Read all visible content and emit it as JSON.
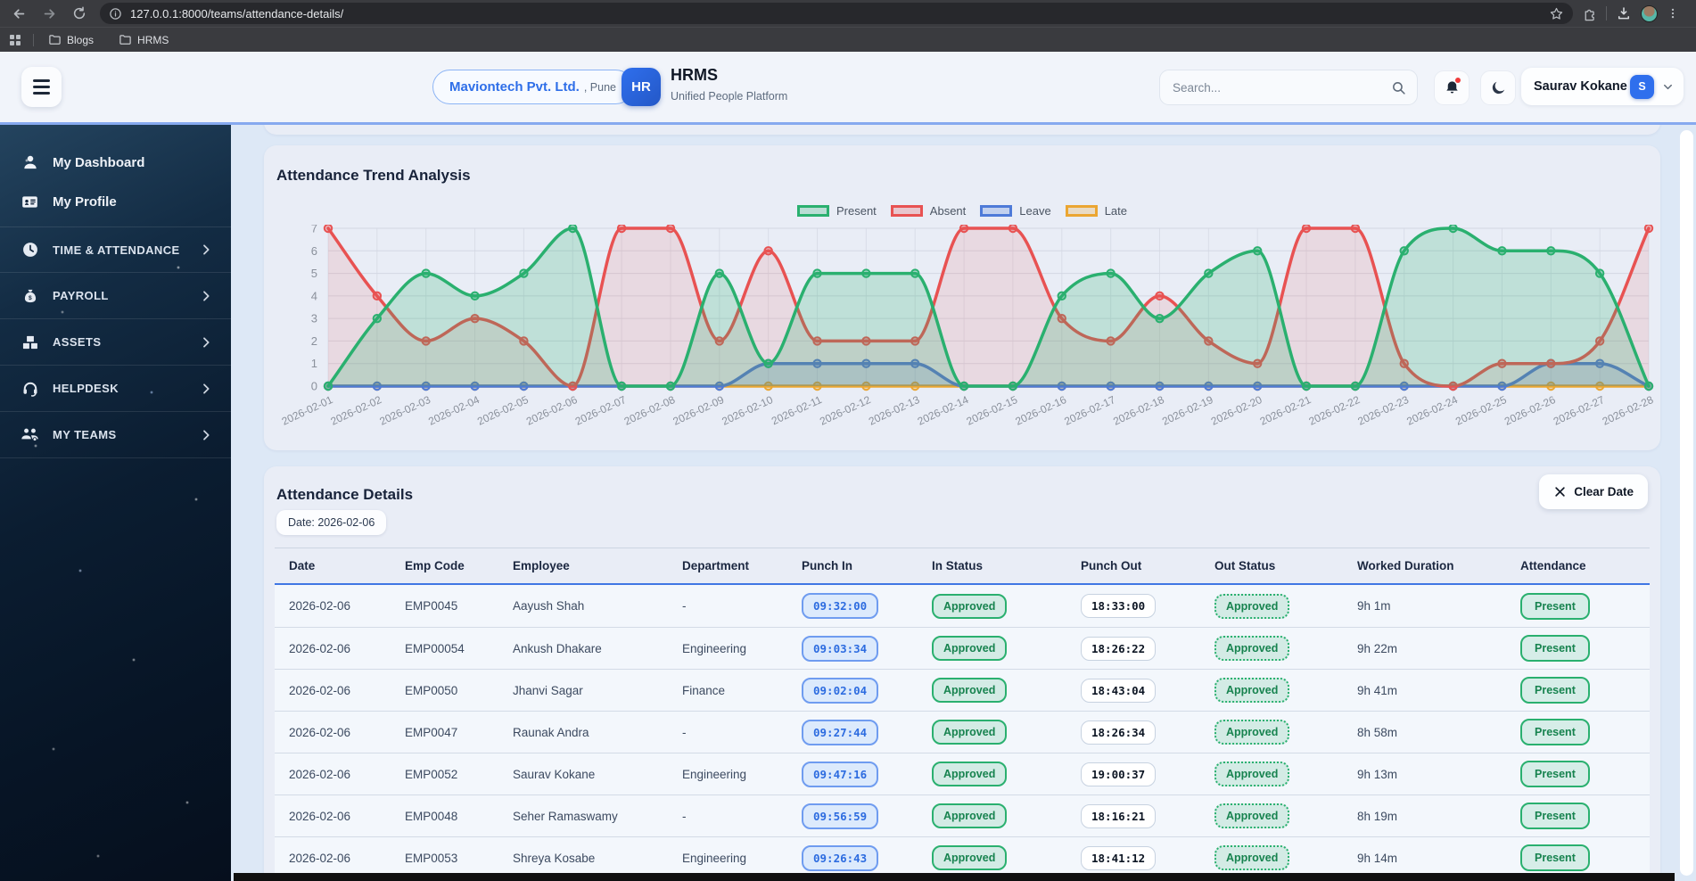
{
  "browser": {
    "url": "127.0.0.1:8000/teams/attendance-details/",
    "bookmarks": [
      {
        "label": "Blogs"
      },
      {
        "label": "HRMS"
      }
    ]
  },
  "header": {
    "company_name": "Maviontech Pvt. Ltd.",
    "company_location": ", Pune",
    "logo_text": "HR",
    "app_name": "HRMS",
    "app_tagline": "Unified People Platform",
    "search_placeholder": "Search...",
    "user_name": "Saurav Kokane",
    "user_initial": "S"
  },
  "sidebar": {
    "items": [
      {
        "label": "My Dashboard",
        "icon": "user-icon",
        "style": "primary",
        "expandable": false
      },
      {
        "label": "My Profile",
        "icon": "id-card-icon",
        "style": "primary",
        "expandable": false
      },
      {
        "label": "TIME & ATTENDANCE",
        "icon": "clock-icon",
        "style": "section",
        "expandable": true
      },
      {
        "label": "PAYROLL",
        "icon": "money-bag-icon",
        "style": "section",
        "expandable": true
      },
      {
        "label": "ASSETS",
        "icon": "boxes-icon",
        "style": "section",
        "expandable": true
      },
      {
        "label": "HELPDESK",
        "icon": "headset-icon",
        "style": "section",
        "expandable": true
      },
      {
        "label": "MY TEAMS",
        "icon": "team-icon",
        "style": "section",
        "expandable": true
      }
    ]
  },
  "chart_card": {
    "title": "Attendance Trend Analysis"
  },
  "chart_data": {
    "type": "line",
    "x": [
      "2026-02-01",
      "2026-02-02",
      "2026-02-03",
      "2026-02-04",
      "2026-02-05",
      "2026-02-06",
      "2026-02-07",
      "2026-02-08",
      "2026-02-09",
      "2026-02-10",
      "2026-02-11",
      "2026-02-12",
      "2026-02-13",
      "2026-02-14",
      "2026-02-15",
      "2026-02-16",
      "2026-02-17",
      "2026-02-18",
      "2026-02-19",
      "2026-02-20",
      "2026-02-21",
      "2026-02-22",
      "2026-02-23",
      "2026-02-24",
      "2026-02-25",
      "2026-02-26",
      "2026-02-27",
      "2026-02-28"
    ],
    "series": [
      {
        "name": "Present",
        "color": "#2ab06f",
        "values": [
          0,
          3,
          5,
          4,
          5,
          7,
          0,
          0,
          5,
          1,
          5,
          5,
          5,
          0,
          0,
          4,
          5,
          3,
          5,
          6,
          0,
          0,
          6,
          7,
          6,
          6,
          5,
          0
        ]
      },
      {
        "name": "Absent",
        "color": "#e85252",
        "values": [
          7,
          4,
          2,
          3,
          2,
          0,
          7,
          7,
          2,
          6,
          2,
          2,
          2,
          7,
          7,
          3,
          2,
          4,
          2,
          1,
          7,
          7,
          1,
          0,
          1,
          1,
          2,
          7
        ]
      },
      {
        "name": "Leave",
        "color": "#4e7ad8",
        "values": [
          0,
          0,
          0,
          0,
          0,
          0,
          0,
          0,
          0,
          1,
          1,
          1,
          1,
          0,
          0,
          0,
          0,
          0,
          0,
          0,
          0,
          0,
          0,
          0,
          0,
          1,
          1,
          0
        ]
      },
      {
        "name": "Late",
        "color": "#eba632",
        "values": [
          0,
          0,
          0,
          0,
          0,
          0,
          0,
          0,
          0,
          0,
          0,
          0,
          0,
          0,
          0,
          0,
          0,
          0,
          0,
          0,
          0,
          0,
          0,
          0,
          0,
          0,
          0,
          0
        ]
      }
    ],
    "ylim": [
      0,
      7
    ],
    "yticks": [
      0,
      1,
      2,
      3,
      4,
      5,
      6,
      7
    ],
    "legend_position": "top",
    "grid": true
  },
  "details_card": {
    "title": "Attendance Details",
    "clear_button": "Clear Date",
    "date_filter": "Date: 2026-02-06",
    "columns": [
      "Date",
      "Emp Code",
      "Employee",
      "Department",
      "Punch In",
      "In Status",
      "Punch Out",
      "Out Status",
      "Worked Duration",
      "Attendance"
    ],
    "rows": [
      {
        "date": "2026-02-06",
        "emp_code": "EMP0045",
        "employee": "Aayush Shah",
        "department": "-",
        "punch_in": "09:32:00",
        "in_status": "Approved",
        "punch_out": "18:33:00",
        "out_status": "Approved",
        "worked_duration": "9h 1m",
        "attendance": "Present"
      },
      {
        "date": "2026-02-06",
        "emp_code": "EMP00054",
        "employee": "Ankush Dhakare",
        "department": "Engineering",
        "punch_in": "09:03:34",
        "in_status": "Approved",
        "punch_out": "18:26:22",
        "out_status": "Approved",
        "worked_duration": "9h 22m",
        "attendance": "Present"
      },
      {
        "date": "2026-02-06",
        "emp_code": "EMP0050",
        "employee": "Jhanvi Sagar",
        "department": "Finance",
        "punch_in": "09:02:04",
        "in_status": "Approved",
        "punch_out": "18:43:04",
        "out_status": "Approved",
        "worked_duration": "9h 41m",
        "attendance": "Present"
      },
      {
        "date": "2026-02-06",
        "emp_code": "EMP0047",
        "employee": "Raunak Andra",
        "department": "-",
        "punch_in": "09:27:44",
        "in_status": "Approved",
        "punch_out": "18:26:34",
        "out_status": "Approved",
        "worked_duration": "8h 58m",
        "attendance": "Present"
      },
      {
        "date": "2026-02-06",
        "emp_code": "EMP0052",
        "employee": "Saurav Kokane",
        "department": "Engineering",
        "punch_in": "09:47:16",
        "in_status": "Approved",
        "punch_out": "19:00:37",
        "out_status": "Approved",
        "worked_duration": "9h 13m",
        "attendance": "Present"
      },
      {
        "date": "2026-02-06",
        "emp_code": "EMP0048",
        "employee": "Seher Ramaswamy",
        "department": "-",
        "punch_in": "09:56:59",
        "in_status": "Approved",
        "punch_out": "18:16:21",
        "out_status": "Approved",
        "worked_duration": "8h 19m",
        "attendance": "Present"
      },
      {
        "date": "2026-02-06",
        "emp_code": "EMP0053",
        "employee": "Shreya Kosabe",
        "department": "Engineering",
        "punch_in": "09:26:43",
        "in_status": "Approved",
        "punch_out": "18:41:12",
        "out_status": "Approved",
        "worked_duration": "9h 14m",
        "attendance": "Present"
      }
    ]
  }
}
